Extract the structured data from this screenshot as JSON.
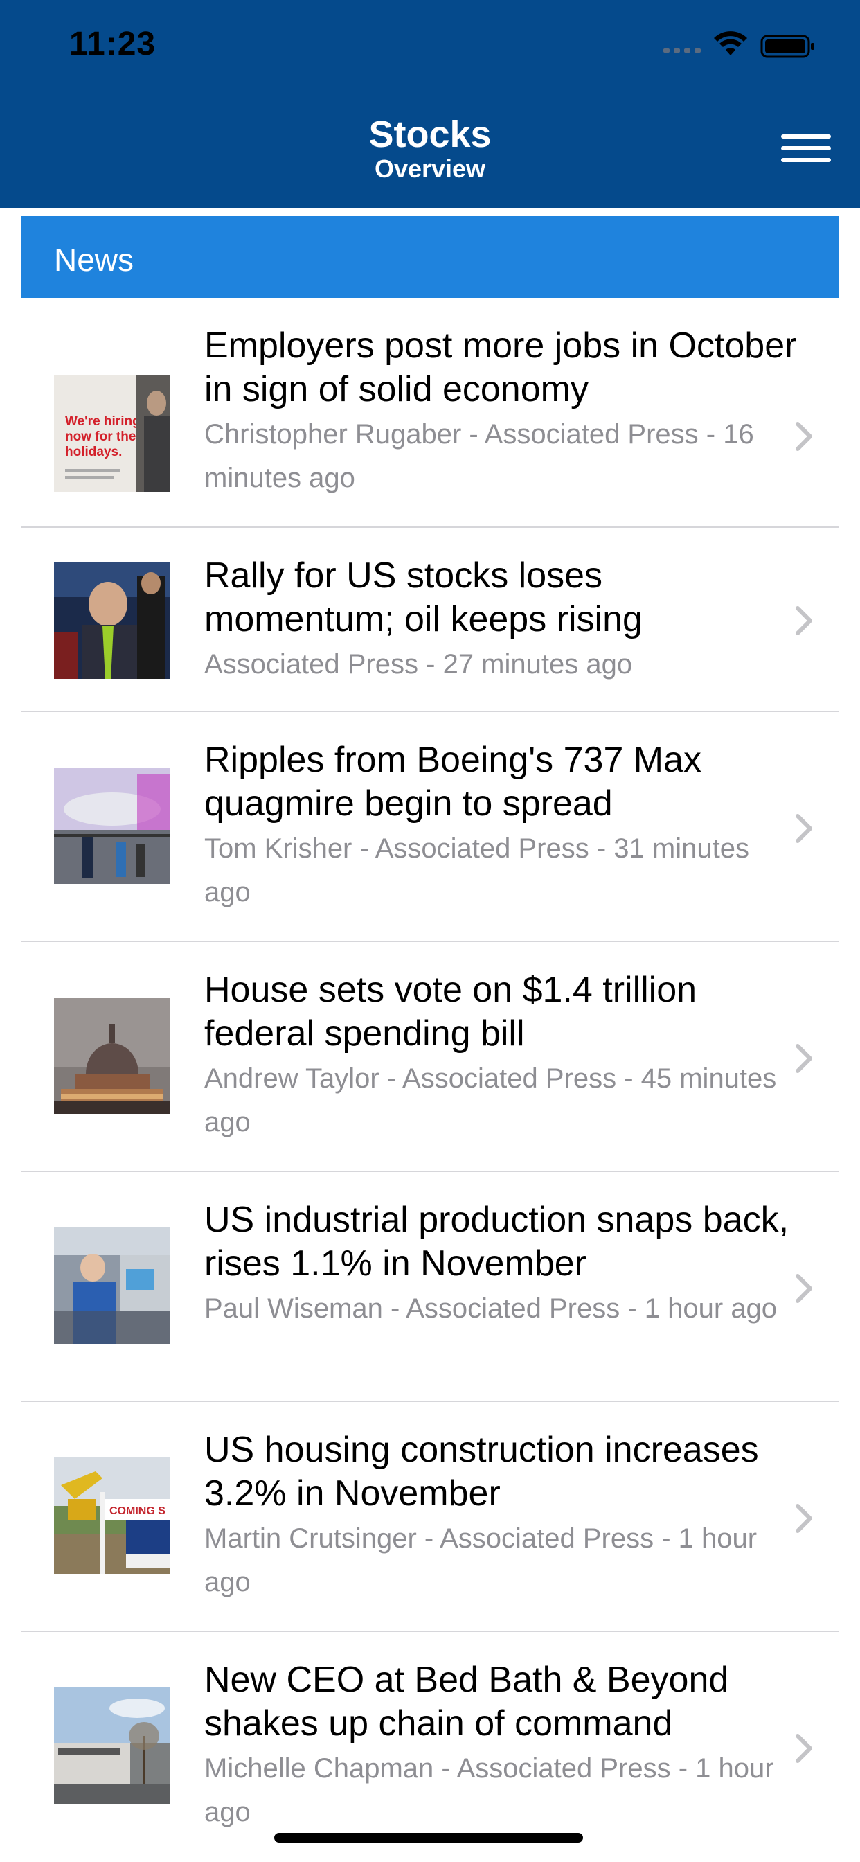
{
  "status_bar": {
    "time": "11:23"
  },
  "nav": {
    "title": "Stocks",
    "subtitle": "Overview"
  },
  "section": {
    "title": "News"
  },
  "news": [
    {
      "headline": "Employers post more jobs in October in sign of solid economy",
      "meta": "Christopher Rugaber - Associated Press - 16 minutes ago",
      "thumb": "hiring-sign-photo"
    },
    {
      "headline": "Rally for US stocks loses momentum; oil keeps rising",
      "meta": "Associated Press - 27 minutes ago",
      "thumb": "stock-trader-photo"
    },
    {
      "headline": "Ripples from Boeing's 737 Max quagmire begin to spread",
      "meta": "Tom Krisher - Associated Press - 31 minutes ago",
      "thumb": "boeing-hangar-photo"
    },
    {
      "headline": "House sets vote on $1.4 trillion federal spending bill",
      "meta": "Andrew Taylor - Associated Press - 45 minutes ago",
      "thumb": "capitol-dome-photo"
    },
    {
      "headline": "US industrial production snaps back, rises 1.1% in November",
      "meta": "Paul Wiseman - Associated Press - 1 hour ago",
      "thumb": "factory-worker-photo"
    },
    {
      "headline": "US housing construction increases 3.2% in November",
      "meta": "Martin Crutsinger - Associated Press - 1 hour ago",
      "thumb": "construction-site-photo"
    },
    {
      "headline": "New CEO at Bed Bath & Beyond shakes up chain of command",
      "meta": "Michelle Chapman - Associated Press - 1 hour ago",
      "thumb": "store-front-photo"
    }
  ],
  "colors": {
    "header": "#054a8c",
    "section": "#1f83dd",
    "meta": "#8e8e93"
  }
}
